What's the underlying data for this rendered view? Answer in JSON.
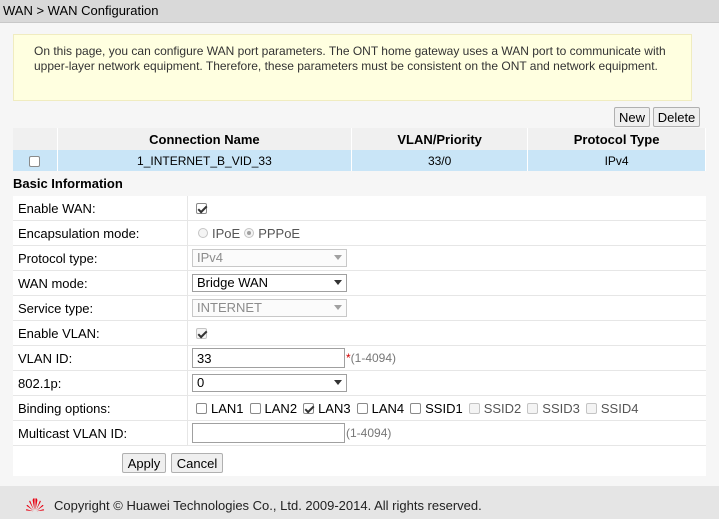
{
  "breadcrumb": "WAN > WAN Configuration",
  "notice": "On this page, you can configure WAN port parameters. The ONT home gateway uses a WAN port to communicate with upper-layer network equipment. Therefore, these parameters must be consistent on the ONT and network equipment.",
  "toolbar": {
    "new_label": "New",
    "delete_label": "Delete"
  },
  "table": {
    "headers": [
      "Connection Name",
      "VLAN/Priority",
      "Protocol Type"
    ],
    "rows": [
      {
        "name": "1_INTERNET_B_VID_33",
        "vlan_priority": "33/0",
        "protocol": "IPv4"
      }
    ]
  },
  "section_title": "Basic Information",
  "form": {
    "enable_wan": {
      "label": "Enable WAN:"
    },
    "encapsulation": {
      "label": "Encapsulation mode:",
      "opt1": "IPoE",
      "opt2": "PPPoE",
      "selected": "PPPoE"
    },
    "protocol_type": {
      "label": "Protocol type:",
      "value": "IPv4"
    },
    "wan_mode": {
      "label": "WAN mode:",
      "value": "Bridge WAN"
    },
    "service_type": {
      "label": "Service type:",
      "value": "INTERNET"
    },
    "enable_vlan": {
      "label": "Enable VLAN:"
    },
    "vlan_id": {
      "label": "VLAN ID:",
      "value": "33",
      "required": "*",
      "hint": "(1-4094)"
    },
    "dot1p": {
      "label": "802.1p:",
      "value": "0"
    },
    "binding": {
      "label": "Binding options:",
      "lan1": "LAN1",
      "lan2": "LAN2",
      "lan3": "LAN3",
      "lan4": "LAN4",
      "ssid1": "SSID1",
      "ssid2": "SSID2",
      "ssid3": "SSID3",
      "ssid4": "SSID4"
    },
    "multicast_vlan": {
      "label": "Multicast VLAN ID:",
      "value": "",
      "hint": "(1-4094)"
    }
  },
  "actions": {
    "apply_label": "Apply",
    "cancel_label": "Cancel"
  },
  "footer": {
    "copyright": "Copyright © Huawei Technologies Co., Ltd. 2009-2014. All rights reserved."
  },
  "colors": {
    "selected_row": "#c9e5f7",
    "notice_bg": "#ffffe0",
    "brand_red": "#e60012"
  }
}
